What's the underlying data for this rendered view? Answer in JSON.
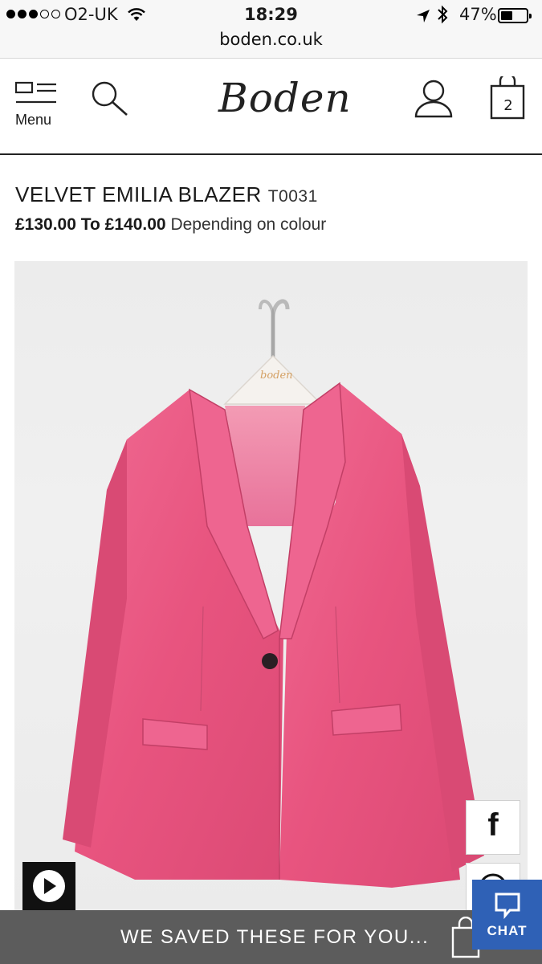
{
  "status_bar": {
    "carrier": "O2-UK",
    "time": "18:29",
    "battery_percent": "47%",
    "battery_level": 0.47,
    "signal_bars_filled": 3,
    "signal_bars_total": 5,
    "url": "boden.co.uk"
  },
  "header": {
    "menu_label": "Menu",
    "logo_text": "Boden",
    "bag_count": "2"
  },
  "product": {
    "title": "VELVET EMILIA BLAZER",
    "code": "T0031",
    "price_range": "£130.00 To £140.00",
    "price_note": "Depending on colour",
    "hanger_brand": "boden",
    "image_color": "#e8547f"
  },
  "social": {
    "facebook_glyph": "f"
  },
  "bottom_bar": {
    "saved_text": "WE SAVED THESE FOR YOU...",
    "chat_label": "CHAT"
  },
  "colors": {
    "chat_blue": "#2f61b6",
    "saved_bar_grey": "#5c5c5c",
    "blazer_pink": "#e8547f"
  }
}
